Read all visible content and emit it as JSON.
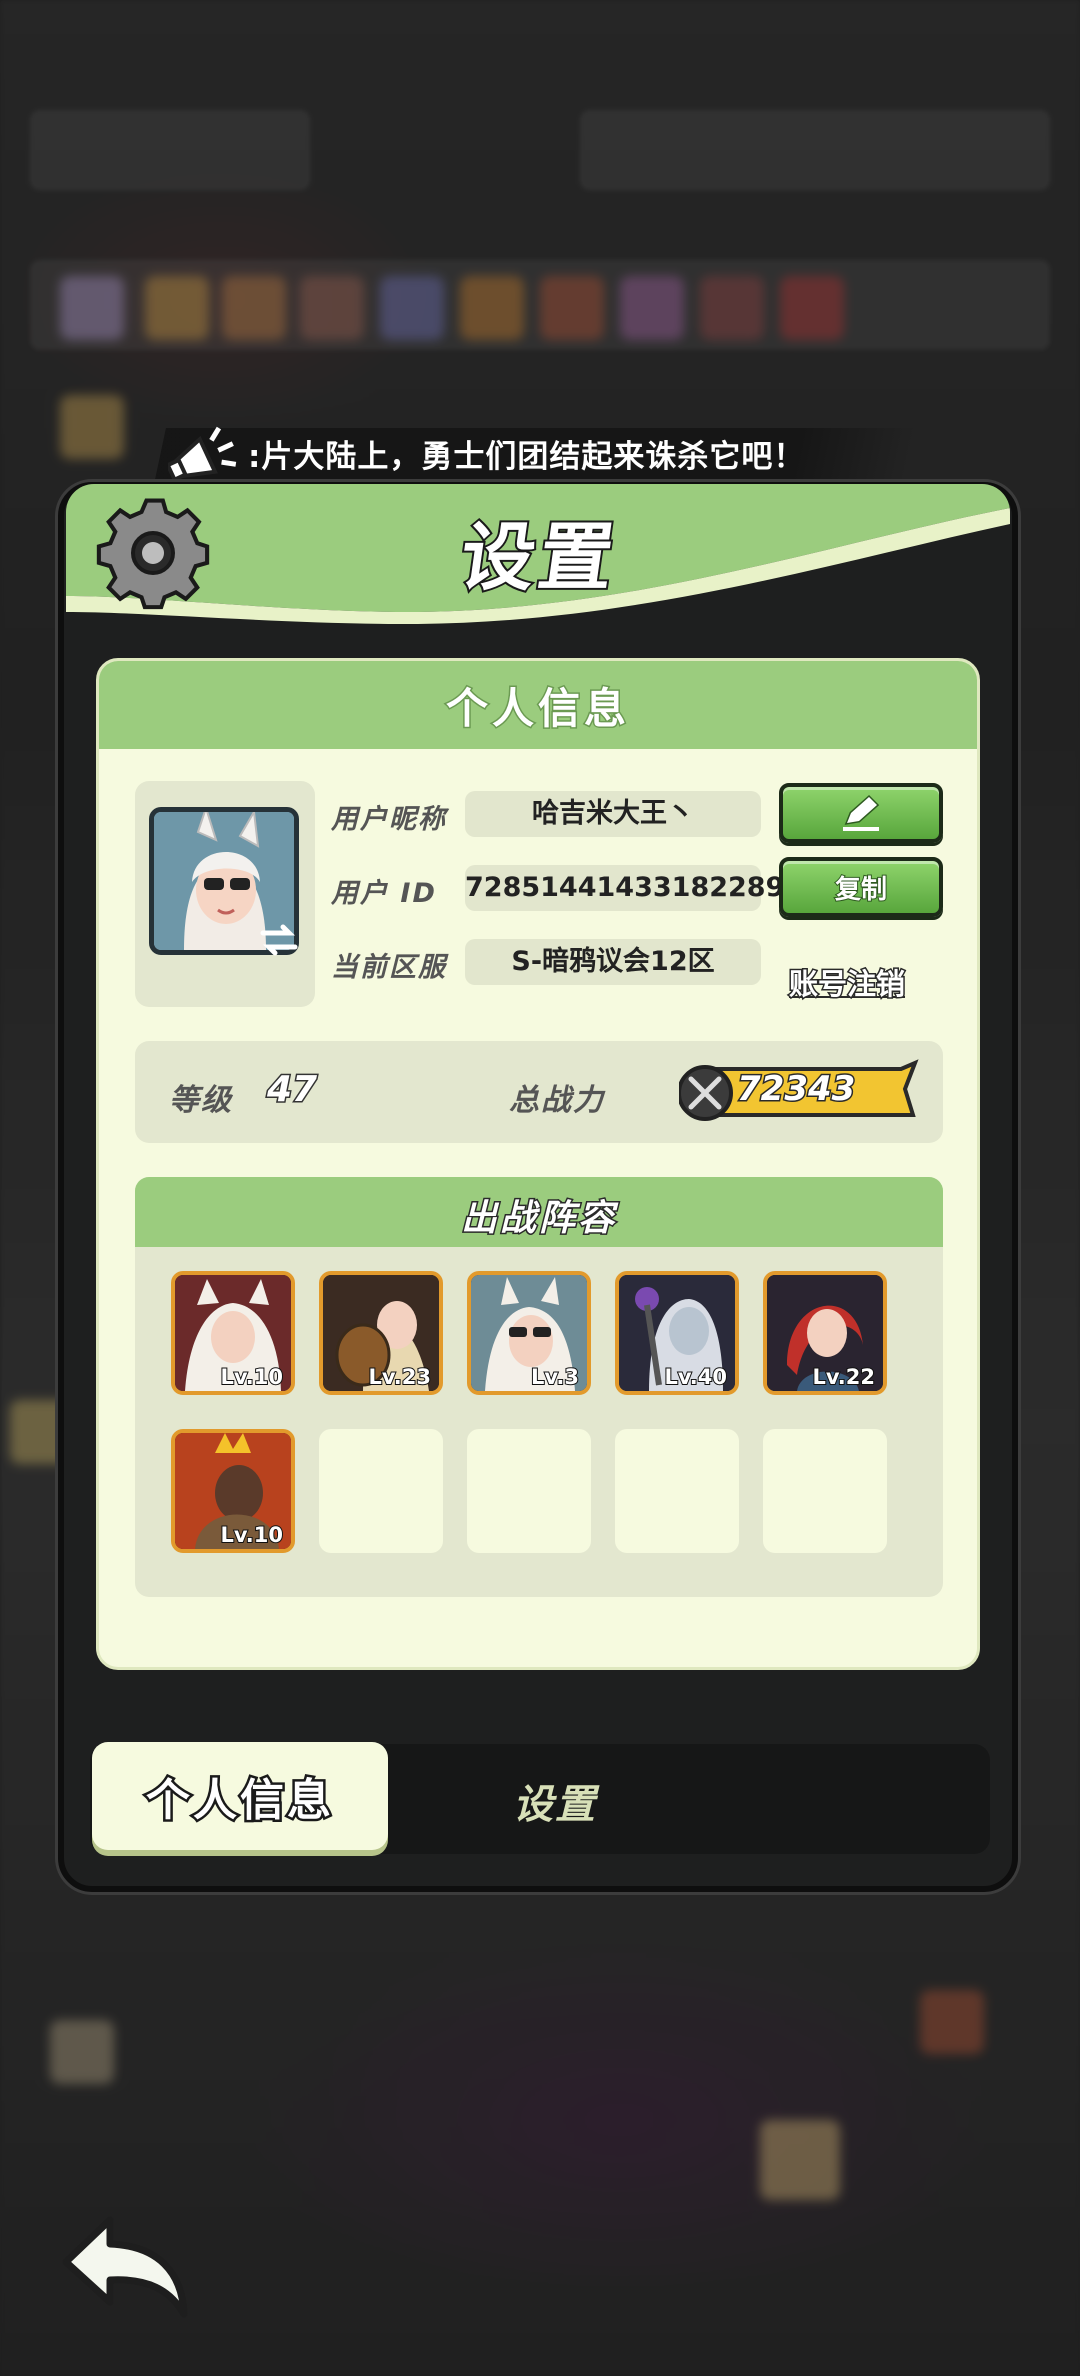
{
  "marquee": {
    "text": ":片大陆上，勇士们团结起来诛杀它吧！"
  },
  "panel": {
    "title": "设置"
  },
  "profile_section": {
    "title": "个人信息",
    "nickname_label": "用户昵称",
    "nickname_value": "哈吉米大王丶",
    "id_label": "用户 ID",
    "id_value": "72851441433182289",
    "copy_label": "复制",
    "server_label": "当前区服",
    "server_value": "S-暗鸦议会12区",
    "cancel_account_label": "账号注销"
  },
  "stats": {
    "level_label": "等级",
    "level_value": "47",
    "power_label": "总战力",
    "power_value": "72343"
  },
  "lineup": {
    "title": "出战阵容",
    "heroes": [
      {
        "level": "Lv.10"
      },
      {
        "level": "Lv.23"
      },
      {
        "level": "Lv.3"
      },
      {
        "level": "Lv.40"
      },
      {
        "level": "Lv.22"
      },
      {
        "level": "Lv.10"
      }
    ]
  },
  "tabs": [
    {
      "label": "个人信息",
      "active": true
    },
    {
      "label": "设置",
      "active": false
    }
  ],
  "colors": {
    "header_green": "#9bcc7e",
    "content_bg": "#f6fadf",
    "button_green": "#58a63c",
    "hero_border": "#e29a2c",
    "power_gold": "#f2c531"
  }
}
